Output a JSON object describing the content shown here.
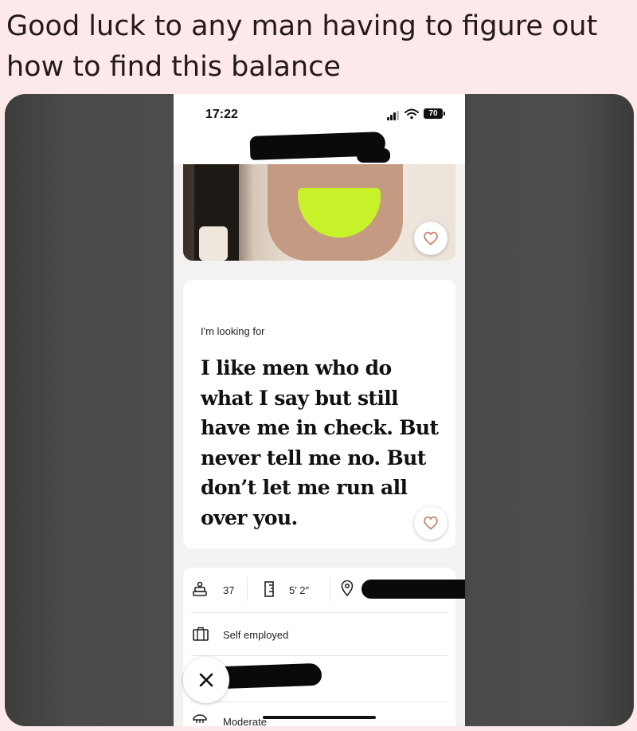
{
  "caption": "Good luck to any man having to figure out how to find this balance",
  "status_bar": {
    "time": "17:22",
    "battery": "70"
  },
  "prompt": {
    "label": "I'm looking for",
    "answer": "I like men who do what I say but still have me in check. But never tell me no. But don’t let me run all over you."
  },
  "vitals": {
    "age": "37",
    "height": "5′ 2″",
    "work": "Self employed",
    "drinking": "Moderate"
  },
  "icons": [
    "signal-icon",
    "wifi-icon",
    "battery-icon",
    "more-icon",
    "heart-icon",
    "age-icon",
    "ruler-icon",
    "location-pin-icon",
    "briefcase-icon",
    "close-icon",
    "drink-icon"
  ],
  "colors": {
    "background": "#fde9e9",
    "heart": "#c9856e",
    "photo_highlight": "#c8f22a"
  }
}
